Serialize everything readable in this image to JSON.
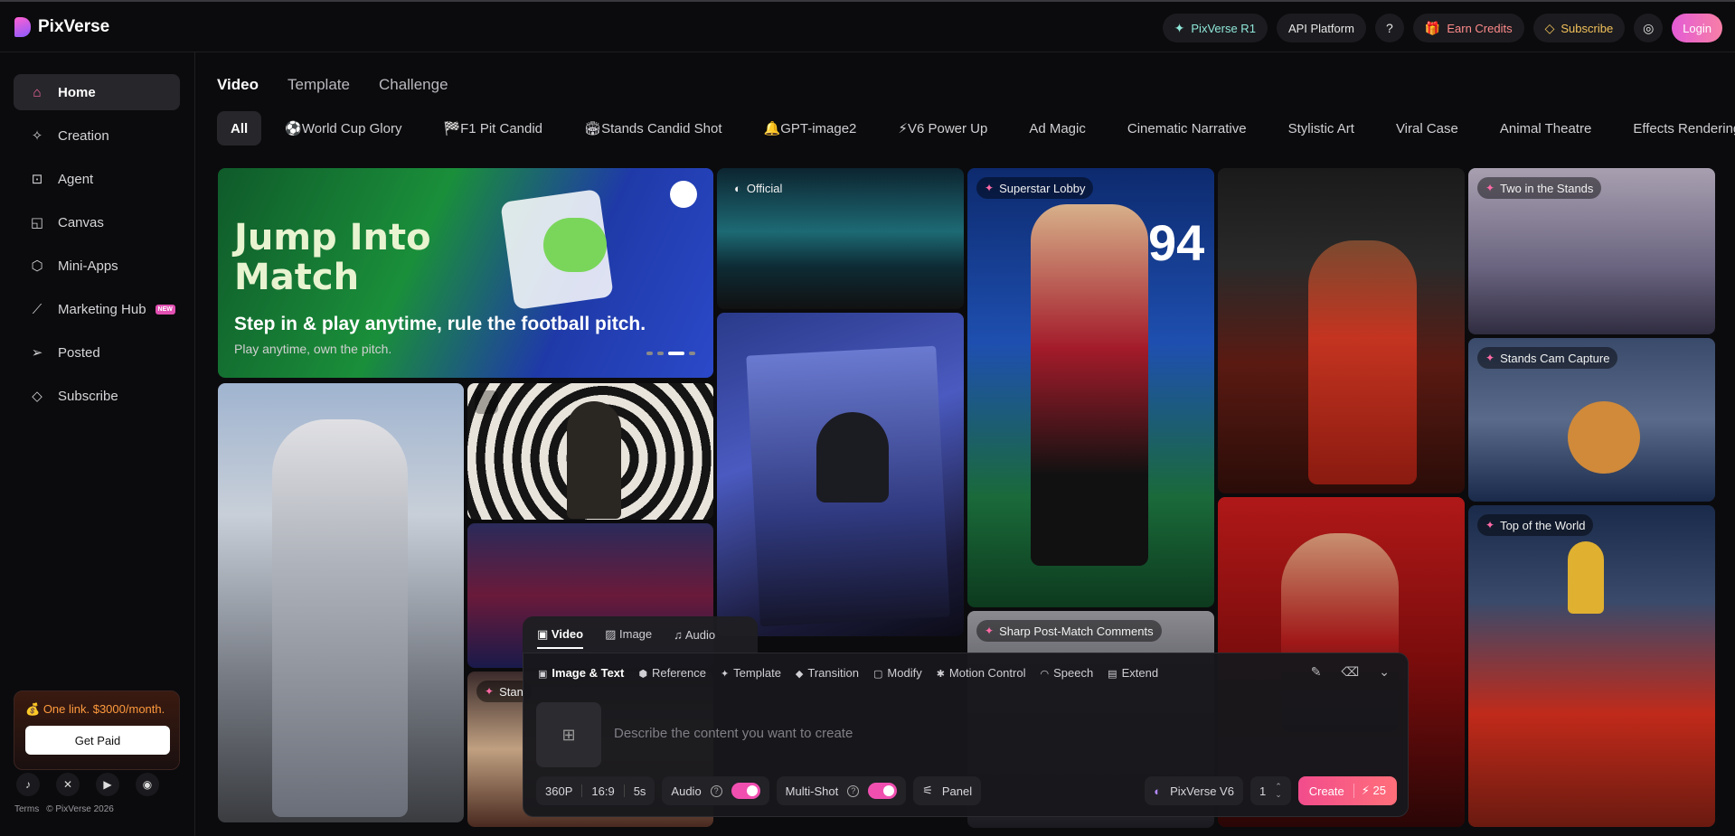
{
  "header": {
    "brand": "PixVerse",
    "r1": "PixVerse R1",
    "api": "API Platform",
    "earn": "Earn Credits",
    "subscribe": "Subscribe",
    "login": "Login"
  },
  "sidebar": {
    "items": [
      {
        "label": "Home",
        "icon": "home-icon"
      },
      {
        "label": "Creation",
        "icon": "sparkle-icon"
      },
      {
        "label": "Agent",
        "icon": "robot-icon"
      },
      {
        "label": "Canvas",
        "icon": "canvas-icon"
      },
      {
        "label": "Mini-Apps",
        "icon": "cube-icon"
      },
      {
        "label": "Marketing Hub",
        "icon": "chart-icon",
        "badge": "NEW"
      },
      {
        "label": "Posted",
        "icon": "send-icon"
      },
      {
        "label": "Subscribe",
        "icon": "diamond-icon"
      }
    ],
    "promo_text": "One link. $3000/month.",
    "promo_button": "Get Paid",
    "terms": "Terms",
    "copyright": "© PixVerse 2026"
  },
  "tabs": [
    "Video",
    "Template",
    "Challenge"
  ],
  "chips": [
    "All",
    "World Cup Glory",
    "F1 Pit Candid",
    "Stands Candid Shot",
    "GPT-image2",
    "V6 Power Up",
    "Ad Magic",
    "Cinematic Narrative",
    "Stylistic Art",
    "Viral Case",
    "Animal Theatre",
    "Effects Rendering"
  ],
  "hero": {
    "title_line1": "Jump Into",
    "title_line2": "Match",
    "subtitle": "Step in & play anytime, rule the football pitch.",
    "subtitle2": "Play anytime, own the pitch."
  },
  "cards": {
    "official": "Official",
    "superstar": "Superstar Lobby",
    "two_stands": "Two in the Stands",
    "stands_cam": "Stands Cam Capture",
    "top_world": "Top of the World",
    "sharp_comments": "Sharp Post-Match Comments",
    "stan": "Stan"
  },
  "composer": {
    "tabs": [
      "Video",
      "Image",
      "Audio"
    ],
    "modes": [
      "Image & Text",
      "Reference",
      "Template",
      "Transition",
      "Modify",
      "Motion Control",
      "Speech",
      "Extend"
    ],
    "placeholder": "Describe the content you want to create",
    "resolution": "360P",
    "ratio": "16:9",
    "duration": "5s",
    "audio": "Audio",
    "multishot": "Multi-Shot",
    "panel": "Panel",
    "model": "PixVerse V6",
    "count": "1",
    "create": "Create",
    "credits": "25"
  },
  "colors": {
    "accent": "#f24c8c",
    "bg": "#0b0b0d"
  }
}
